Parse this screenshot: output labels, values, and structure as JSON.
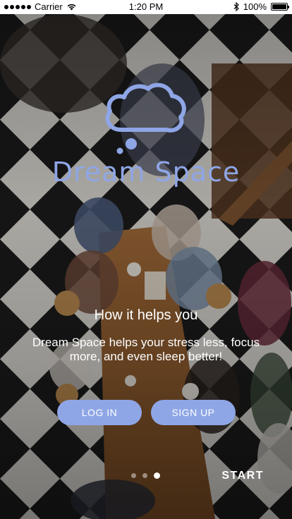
{
  "status_bar": {
    "carrier": "Carrier",
    "time": "1:20 PM",
    "battery": "100%",
    "icons": [
      "signal-icon",
      "wifi-icon",
      "bluetooth-icon",
      "battery-icon"
    ]
  },
  "logo": {
    "icon": "cloud-icon",
    "title": "Dream Space"
  },
  "onboarding": {
    "heading": "How it helps you",
    "body": "Dream Space helps your stress less, focus more, and even sleep better!",
    "page_count": 3,
    "active_page": 3
  },
  "actions": {
    "login_label": "LOG IN",
    "signup_label": "SIGN UP",
    "start_label": "START"
  },
  "colors": {
    "accent": "#8fa6e6",
    "text": "#ffffff",
    "status_bar_bg": "#ffffff"
  }
}
